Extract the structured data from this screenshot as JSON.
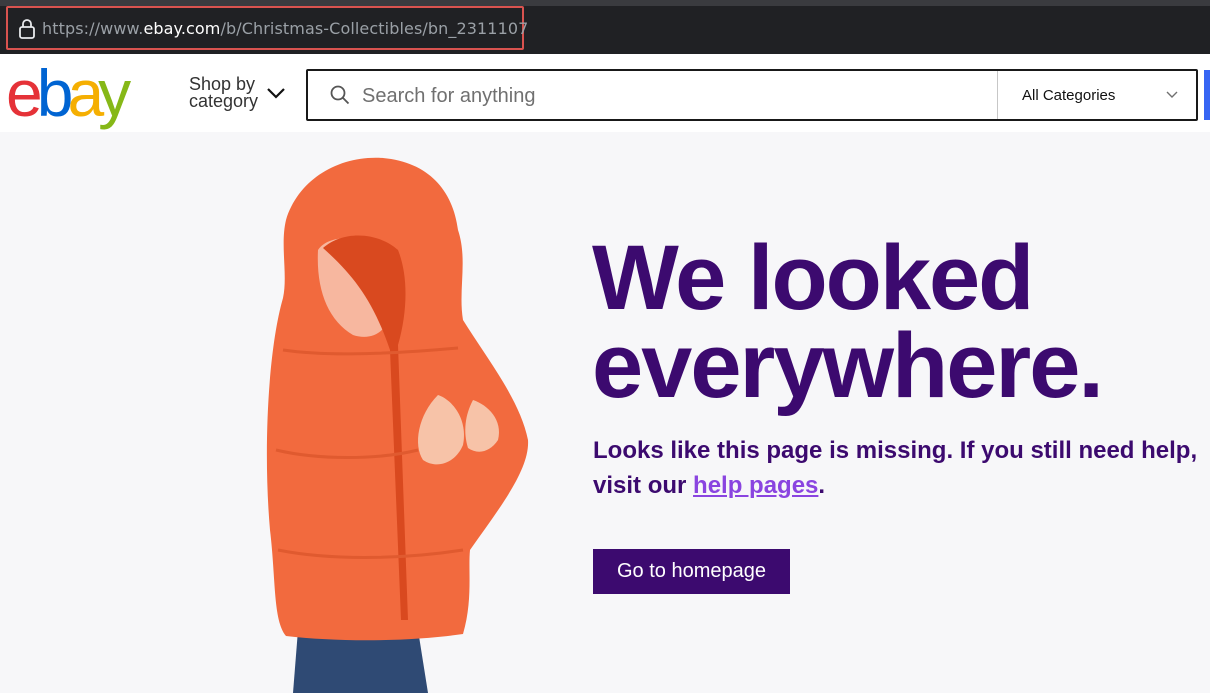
{
  "browser": {
    "url_prefix": "https://www.",
    "url_host": "ebay.com",
    "url_path": "/b/Christmas-Collectibles/bn_2311107"
  },
  "header": {
    "logo_letters": [
      {
        "char": "e",
        "color": "#e53238"
      },
      {
        "char": "b",
        "color": "#0064d2"
      },
      {
        "char": "a",
        "color": "#f5af02"
      },
      {
        "char": "y",
        "color": "#86b817"
      }
    ],
    "shop_by_line1": "Shop by",
    "shop_by_line2": "category",
    "search_placeholder": "Search for anything",
    "category_selected": "All Categories"
  },
  "main": {
    "headline_line1": "We looked",
    "headline_line2": "everywhere.",
    "message_before": "Looks like this page is missing. If you still need help, visit our ",
    "help_link": "help pages",
    "message_after": ".",
    "button_label": "Go to homepage"
  },
  "colors": {
    "brand_purple": "#3c0a6f",
    "link_purple": "#8a44e0",
    "jacket_orange": "#f26a3e",
    "search_blue": "#3665f3"
  },
  "icons": [
    "lock-icon",
    "chevron-down-icon",
    "search-icon"
  ]
}
